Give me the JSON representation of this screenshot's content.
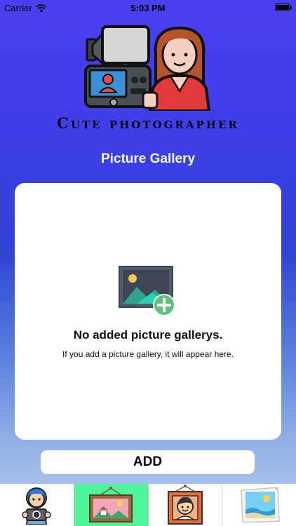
{
  "status_bar": {
    "carrier": "Carrier",
    "time": "5:03 PM",
    "battery_level": 1.0
  },
  "logo": {
    "text": "Cute photographer",
    "icon": "photographer-logo-icon"
  },
  "page_title": "Picture Gallery",
  "empty_state": {
    "icon": "add-image-icon",
    "title": "No added picture gallerys.",
    "description": "If you add a picture gallery, it will appear here."
  },
  "add_button": {
    "label": "ADD"
  },
  "tabs": [
    {
      "icon": "photographer-icon",
      "selected": false
    },
    {
      "icon": "landscape-picture-icon",
      "selected": true
    },
    {
      "icon": "portrait-picture-icon",
      "selected": false
    },
    {
      "icon": "seaside-photo-icon",
      "selected": false
    }
  ],
  "colors": {
    "selected_tab": "#4ff59a",
    "plus_badge": "#5cc27a",
    "background_top": "#4a3ff0",
    "background_bottom": "#b9cdee"
  }
}
